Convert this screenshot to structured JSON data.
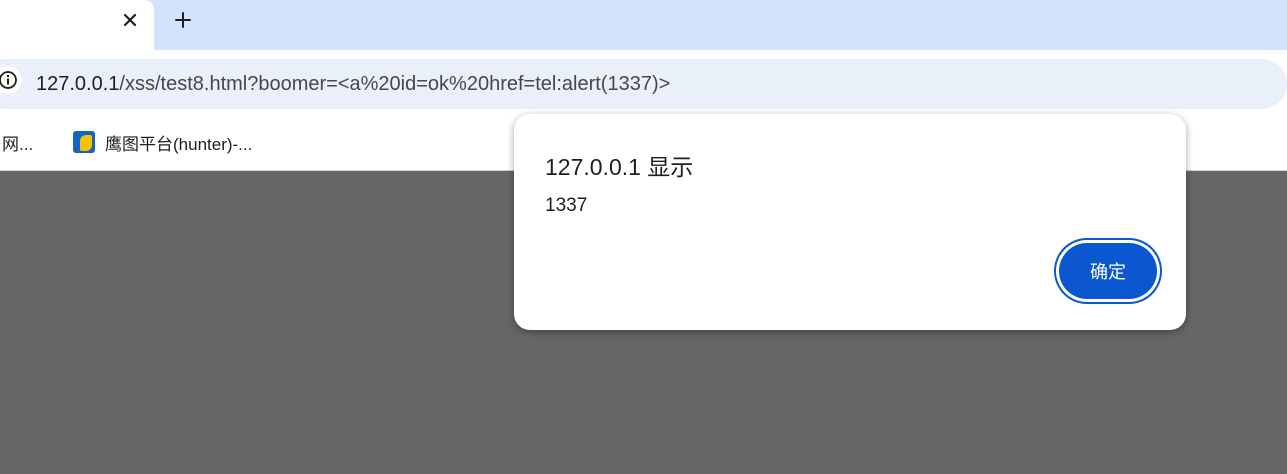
{
  "tab": {
    "close_icon": "×"
  },
  "tabstrip": {
    "new_tab_icon": "+"
  },
  "address_bar": {
    "url_host": "127.0.0.1",
    "url_rest": "/xss/test8.html?boomer=<a%20id=ok%20href=tel:alert(1337)>"
  },
  "bookmarks": [
    {
      "label": "网..."
    },
    {
      "label": "鹰图平台(hunter)-..."
    }
  ],
  "dialog": {
    "title": "127.0.0.1 显示",
    "message": "1337",
    "ok_label": "确定"
  },
  "colors": {
    "tabstrip_bg": "#d3e3fd",
    "omnibox_bg": "#eaf0f9",
    "content_bg": "#666666",
    "button_blue": "#0b57d0"
  }
}
